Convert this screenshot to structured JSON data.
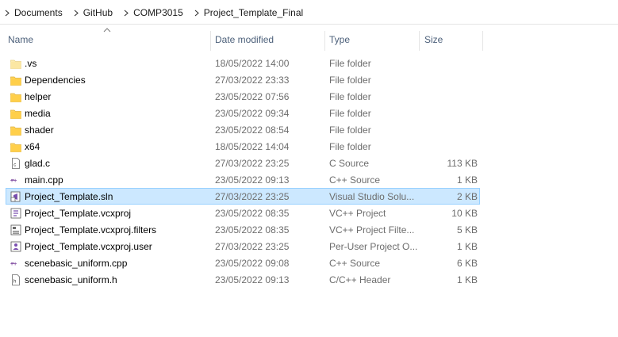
{
  "breadcrumb": [
    {
      "label": "Documents"
    },
    {
      "label": "GitHub"
    },
    {
      "label": "COMP3015"
    },
    {
      "label": "Project_Template_Final"
    }
  ],
  "columns": {
    "name": "Name",
    "date": "Date modified",
    "type": "Type",
    "size": "Size"
  },
  "files": [
    {
      "name": ".vs",
      "date": "18/05/2022 14:00",
      "type": "File folder",
      "size": "",
      "icon": "folder-icon-light"
    },
    {
      "name": "Dependencies",
      "date": "27/03/2022 23:33",
      "type": "File folder",
      "size": "",
      "icon": "folder-icon"
    },
    {
      "name": "helper",
      "date": "23/05/2022 07:56",
      "type": "File folder",
      "size": "",
      "icon": "folder-icon"
    },
    {
      "name": "media",
      "date": "23/05/2022 09:34",
      "type": "File folder",
      "size": "",
      "icon": "folder-icon"
    },
    {
      "name": "shader",
      "date": "23/05/2022 08:54",
      "type": "File folder",
      "size": "",
      "icon": "folder-icon"
    },
    {
      "name": "x64",
      "date": "18/05/2022 14:04",
      "type": "File folder",
      "size": "",
      "icon": "folder-icon"
    },
    {
      "name": "glad.c",
      "date": "27/03/2022 23:25",
      "type": "C Source",
      "size": "113 KB",
      "icon": "c-source-icon"
    },
    {
      "name": "main.cpp",
      "date": "23/05/2022 09:13",
      "type": "C++ Source",
      "size": "1 KB",
      "icon": "cpp-source-icon"
    },
    {
      "name": "Project_Template.sln",
      "date": "27/03/2022 23:25",
      "type": "Visual Studio Solu...",
      "size": "2 KB",
      "icon": "sln-icon",
      "selected": true
    },
    {
      "name": "Project_Template.vcxproj",
      "date": "23/05/2022 08:35",
      "type": "VC++ Project",
      "size": "10 KB",
      "icon": "vcxproj-icon"
    },
    {
      "name": "Project_Template.vcxproj.filters",
      "date": "23/05/2022 08:35",
      "type": "VC++ Project Filte...",
      "size": "5 KB",
      "icon": "filters-icon"
    },
    {
      "name": "Project_Template.vcxproj.user",
      "date": "27/03/2022 23:25",
      "type": "Per-User Project O...",
      "size": "1 KB",
      "icon": "user-project-icon"
    },
    {
      "name": "scenebasic_uniform.cpp",
      "date": "23/05/2022 09:08",
      "type": "C++ Source",
      "size": "6 KB",
      "icon": "cpp-source-icon"
    },
    {
      "name": "scenebasic_uniform.h",
      "date": "23/05/2022 09:13",
      "type": "C/C++ Header",
      "size": "1 KB",
      "icon": "header-icon"
    }
  ],
  "colors": {
    "selection": "#cce8ff",
    "selection_border": "#99d1ff",
    "folder": "#ffd35c",
    "folder_light": "#fcebb0"
  }
}
